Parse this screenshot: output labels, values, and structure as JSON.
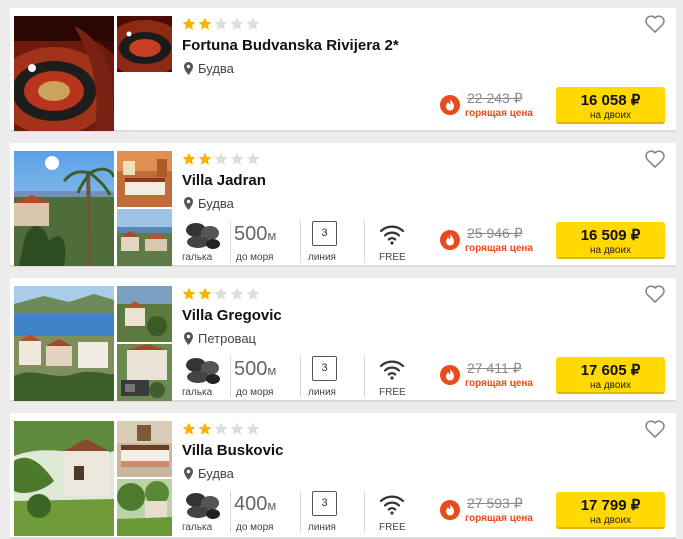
{
  "colors": {
    "accent": "#ffd900",
    "hot": "#e94b1a",
    "star_on": "#f6b400",
    "star_off": "#dddddd"
  },
  "hotels": [
    {
      "name": "Fortuna Budvanska Rivijera 2*",
      "location": "Будва",
      "stars": 2,
      "max_stars": 5,
      "amenities": null,
      "old_price": "22 243 ₽",
      "hot_label": "горящая цена",
      "price": "16 058 ₽",
      "price_sub": "на двоих",
      "photos": [
        "casino-roulette",
        "casino-roulette"
      ]
    },
    {
      "name": "Villa Jadran",
      "location": "Будва",
      "stars": 2,
      "max_stars": 5,
      "amenities": {
        "beach": "галька",
        "distance": "500",
        "distance_unit": "м",
        "distance_label": "до моря",
        "line": "3",
        "line_label": "линия",
        "wifi": "FREE"
      },
      "old_price": "25 946 ₽",
      "hot_label": "горящая цена",
      "price": "16 509 ₽",
      "price_sub": "на двоих",
      "photos": [
        "coast-palms",
        "hotel-room",
        "coast-town"
      ]
    },
    {
      "name": "Villa Gregovic",
      "location": "Петровац",
      "stars": 2,
      "max_stars": 5,
      "amenities": {
        "beach": "галька",
        "distance": "500",
        "distance_unit": "м",
        "distance_label": "до моря",
        "line": "3",
        "line_label": "линия",
        "wifi": "FREE"
      },
      "old_price": "27 411 ₽",
      "hot_label": "горящая цена",
      "price": "17 605 ₽",
      "price_sub": "на двоих",
      "photos": [
        "bay-town",
        "villa-garden",
        "villa-parking"
      ]
    },
    {
      "name": "Villa Buskovic",
      "location": "Будва",
      "stars": 2,
      "max_stars": 5,
      "amenities": {
        "beach": "галька",
        "distance": "400",
        "distance_unit": "м",
        "distance_label": "до моря",
        "line": "3",
        "line_label": "линия",
        "wifi": "FREE"
      },
      "old_price": "27 593 ₽",
      "hot_label": "горящая цена",
      "price": "17 799 ₽",
      "price_sub": "на двоих",
      "photos": [
        "garden-house",
        "bedroom",
        "garden-trees"
      ]
    }
  ]
}
